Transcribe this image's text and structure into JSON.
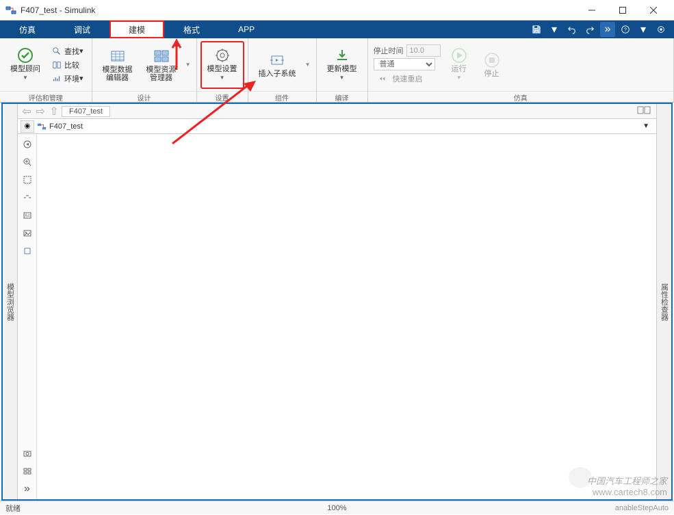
{
  "window": {
    "title": "F407_test - Simulink"
  },
  "tabs": [
    "仿真",
    "调试",
    "建模",
    "格式",
    "APP"
  ],
  "active_tab_index": 2,
  "toolstrip": {
    "eval": {
      "advisor": "模型顾问",
      "find": "查找",
      "compare": "比较",
      "env": "环境",
      "label": "评估和管理"
    },
    "design": {
      "data_editor": "模型数据\n编辑器",
      "resource_mgr": "模型资源\n管理器",
      "label": "设计"
    },
    "settings": {
      "model_settings": "模型设置",
      "label": "设置"
    },
    "component": {
      "insert_subsystem": "插入子系统",
      "label": "组件"
    },
    "compile": {
      "update_model": "更新模型",
      "label": "编译"
    },
    "sim": {
      "stop_time_label": "停止时间",
      "stop_time_value": "10.0",
      "mode": "普通",
      "fast_restart": "快速重启",
      "run": "运行",
      "stop": "停止",
      "label": "仿真"
    }
  },
  "sidebars": {
    "left": "模型浏览器",
    "right": "属性检查器"
  },
  "breadcrumb": {
    "tab": "F407_test",
    "path": "F407_test"
  },
  "status": {
    "ready": "就绪",
    "zoom": "100%",
    "solver": "anableStepAuto"
  },
  "watermark": {
    "line1": "中国汽车工程师之家",
    "line2": "www.cartech8.com"
  }
}
